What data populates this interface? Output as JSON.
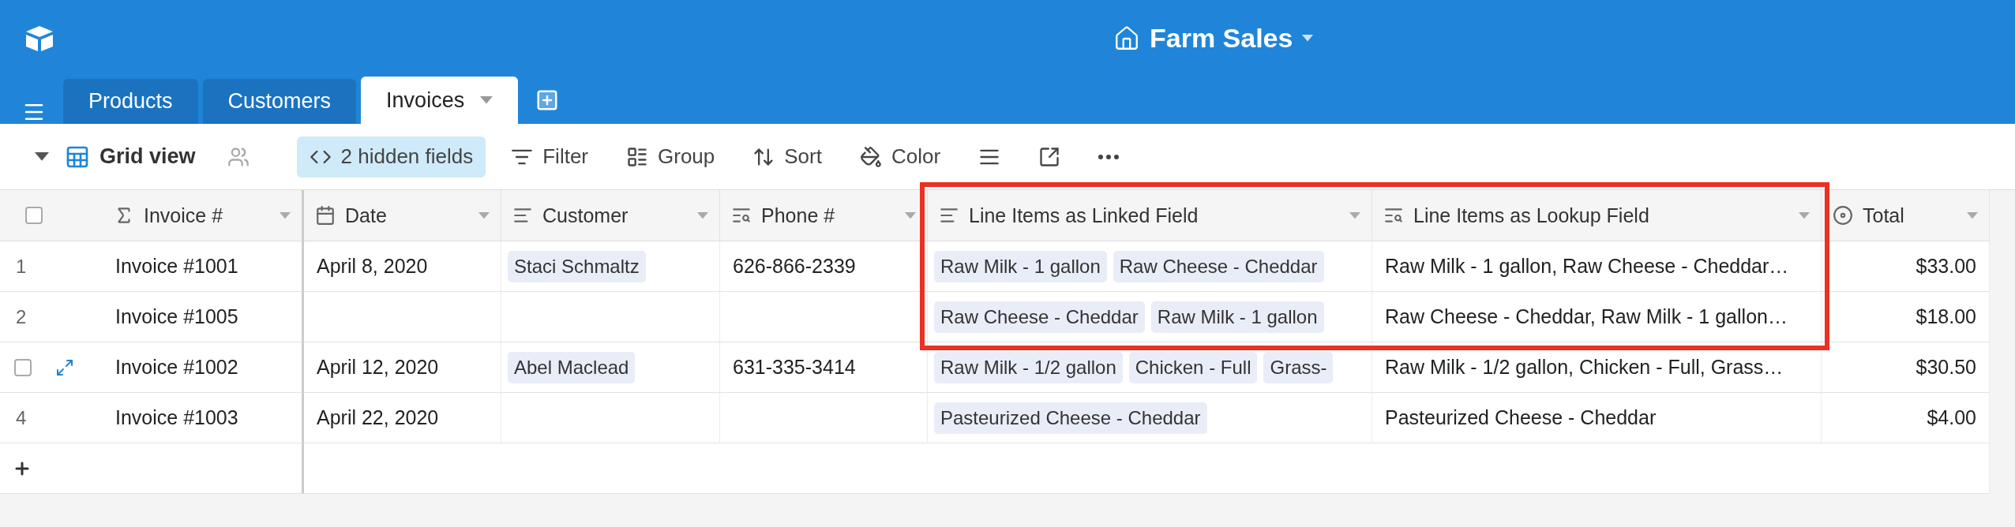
{
  "app": {
    "base_title": "Farm Sales"
  },
  "tabs": [
    {
      "label": "Products",
      "selected": false
    },
    {
      "label": "Customers",
      "selected": false
    },
    {
      "label": "Invoices",
      "selected": true
    }
  ],
  "toolbar": {
    "view_name": "Grid view",
    "items": [
      {
        "kind": "hidden_fields",
        "label": "2 hidden fields",
        "active": true
      },
      {
        "kind": "filter",
        "label": "Filter",
        "active": false
      },
      {
        "kind": "group",
        "label": "Group",
        "active": false
      },
      {
        "kind": "sort",
        "label": "Sort",
        "active": false
      },
      {
        "kind": "color",
        "label": "Color",
        "active": false
      },
      {
        "kind": "row_height",
        "active": false
      },
      {
        "kind": "share",
        "active": false
      },
      {
        "kind": "more",
        "active": false
      }
    ]
  },
  "table": {
    "all_selected": false,
    "columns": [
      {
        "kind": "formula",
        "label": "Invoice #"
      },
      {
        "kind": "date",
        "label": "Date"
      },
      {
        "kind": "link",
        "label": "Customer"
      },
      {
        "kind": "lookup",
        "label": "Phone #"
      },
      {
        "kind": "link",
        "label": "Line Items as Linked Field"
      },
      {
        "kind": "lookup",
        "label": "Line Items as Lookup Field"
      },
      {
        "kind": "rollup",
        "label": "Total"
      }
    ],
    "rows": [
      {
        "number": "1",
        "hovered": false,
        "cells": [
          "Invoice #1001",
          "April 8, 2020",
          [
            "Staci Schmaltz"
          ],
          "626-866-2339",
          [
            "Raw Milk - 1 gallon",
            "Raw Cheese - Cheddar"
          ],
          "Raw Milk - 1 gallon, Raw Cheese - Cheddar…",
          "$33.00"
        ]
      },
      {
        "number": "2",
        "hovered": false,
        "cells": [
          "Invoice #1005",
          null,
          null,
          null,
          [
            "Raw Cheese - Cheddar",
            "Raw Milk - 1 gallon"
          ],
          "Raw Cheese - Cheddar, Raw Milk - 1 gallon…",
          "$18.00"
        ]
      },
      {
        "hovered": true,
        "checked": false,
        "cells": [
          "Invoice #1002",
          "April 12, 2020",
          [
            "Abel Maclead"
          ],
          "631-335-3414",
          [
            "Raw Milk - 1/2 gallon",
            "Chicken - Full",
            "Grass-"
          ],
          "Raw Milk - 1/2 gallon, Chicken - Full, Grass…",
          "$30.50"
        ]
      },
      {
        "number": "4",
        "hovered": false,
        "cells": [
          "Invoice #1003",
          "April 22, 2020",
          null,
          null,
          [
            "Pasteurized Cheese - Cheddar"
          ],
          "Pasteurized Cheese - Cheddar",
          "$4.00"
        ]
      }
    ]
  },
  "annotation": {
    "kind": "frame"
  }
}
